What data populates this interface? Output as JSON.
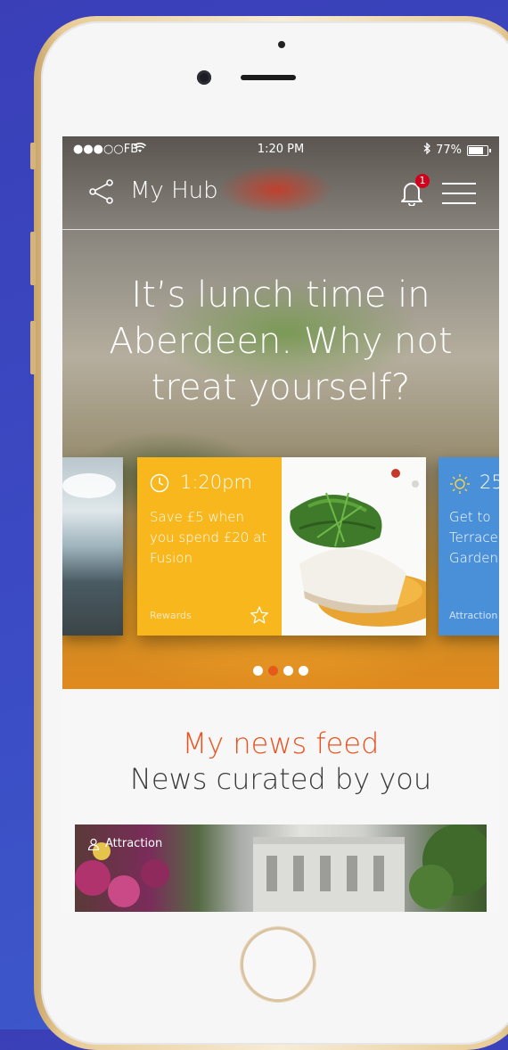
{
  "status_bar": {
    "carrier": "●●●○○FB",
    "time": "1:20 PM",
    "battery": "77%"
  },
  "header": {
    "title": "My Hub",
    "notification_count": "1"
  },
  "hero": {
    "headline": "It’s lunch time in Aberdeen. Why not treat yourself?"
  },
  "cards": {
    "main": {
      "time": "1:20pm",
      "description": "Save £5 when you spend £20 at Fusion",
      "category": "Rewards"
    },
    "next": {
      "temperature": "25",
      "description": "Get to Terrace Garden",
      "category": "Attraction"
    }
  },
  "pagination": {
    "count": 4,
    "active_index": 1
  },
  "feed": {
    "title": "My news feed",
    "subtitle": "News curated by you",
    "first_item_tag": "Attraction"
  },
  "colors": {
    "background": "#3a3fb8",
    "card_yellow": "#f7b71d",
    "card_blue": "#4a90d9",
    "accent_orange": "#e8531f",
    "badge_red": "#d0021b"
  }
}
